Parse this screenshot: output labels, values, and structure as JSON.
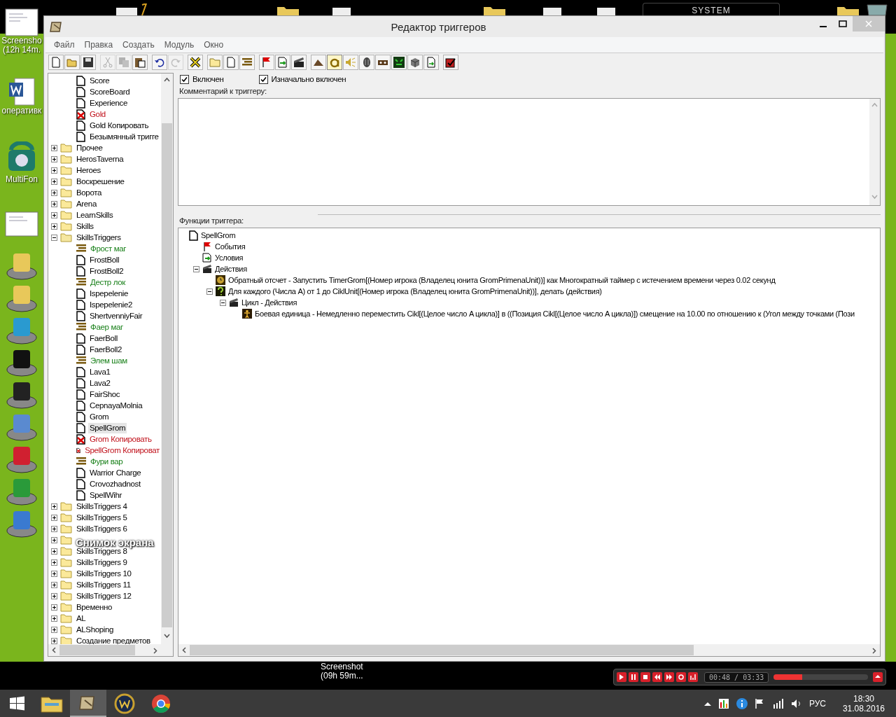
{
  "desktop": {
    "left_icons": [
      {
        "kind": "screenshot",
        "label": [
          "Screensho",
          "(12h 14m."
        ]
      },
      {
        "kind": "word",
        "label": [
          "оперативк"
        ]
      },
      {
        "kind": "phone",
        "label": [
          "MultiFon"
        ]
      },
      {
        "kind": "screenshot-small"
      },
      {
        "kind": "disk-folder"
      },
      {
        "kind": "disk-folder"
      },
      {
        "kind": "disk-signal"
      },
      {
        "kind": "disk-dollar"
      },
      {
        "kind": "disk-v"
      },
      {
        "kind": "disk-map"
      },
      {
        "kind": "disk-download"
      },
      {
        "kind": "disk-chrome"
      },
      {
        "kind": "disk-camera"
      }
    ],
    "overlay_label": "Снимок экрана",
    "system_label": "SYSTEM",
    "bottom_label": [
      "Screenshot",
      "(09h 59m..."
    ]
  },
  "window": {
    "title": "Редактор триггеров"
  },
  "menu": [
    "Файл",
    "Правка",
    "Создать",
    "Модуль",
    "Окно"
  ],
  "toolbar": [
    [
      {
        "kind": "new",
        "disabled": false,
        "pressed": false
      },
      {
        "kind": "open",
        "disabled": false,
        "pressed": false
      },
      {
        "kind": "save",
        "disabled": false,
        "pressed": false
      }
    ],
    [
      {
        "kind": "cut",
        "disabled": true,
        "pressed": false
      },
      {
        "kind": "copy",
        "disabled": true,
        "pressed": false
      },
      {
        "kind": "paste",
        "disabled": false,
        "pressed": false
      }
    ],
    [
      {
        "kind": "undo",
        "disabled": false,
        "pressed": false
      },
      {
        "kind": "redo",
        "disabled": true,
        "pressed": false
      }
    ],
    [
      {
        "kind": "delete",
        "disabled": false,
        "pressed": false
      }
    ],
    [
      {
        "kind": "folder",
        "disabled": false,
        "pressed": false
      },
      {
        "kind": "trigger",
        "disabled": false,
        "pressed": false
      },
      {
        "kind": "comment",
        "disabled": false,
        "pressed": false
      }
    ],
    [
      {
        "kind": "event",
        "disabled": false,
        "pressed": false
      },
      {
        "kind": "condition",
        "disabled": false,
        "pressed": false
      },
      {
        "kind": "action",
        "disabled": false,
        "pressed": false
      }
    ],
    [
      {
        "kind": "terrain",
        "disabled": false,
        "pressed": false
      },
      {
        "kind": "text",
        "disabled": false,
        "pressed": true
      },
      {
        "kind": "sound",
        "disabled": false,
        "pressed": false
      },
      {
        "kind": "unit",
        "disabled": false,
        "pressed": false
      },
      {
        "kind": "object",
        "disabled": false,
        "pressed": false
      },
      {
        "kind": "monster",
        "disabled": false,
        "pressed": false
      },
      {
        "kind": "cube",
        "disabled": false,
        "pressed": false
      },
      {
        "kind": "import",
        "disabled": false,
        "pressed": false
      }
    ],
    [
      {
        "kind": "checklist",
        "disabled": false,
        "pressed": false
      }
    ]
  ],
  "tree": {
    "continued_items": [
      {
        "kind": "trigger",
        "label": "Score",
        "selected": false
      },
      {
        "kind": "trigger",
        "label": "ScoreBoard",
        "selected": false
      },
      {
        "kind": "trigger",
        "label": "Experience",
        "selected": false
      },
      {
        "kind": "disabled-trigger",
        "label": "Gold",
        "selected": false
      },
      {
        "kind": "trigger",
        "label": "Gold Копировать",
        "selected": false
      },
      {
        "kind": "trigger",
        "label": "Безымянный тригге",
        "selected": false
      }
    ],
    "folders": [
      {
        "label": "Прочее",
        "expanded": false
      },
      {
        "label": "HerosTaverna",
        "expanded": false
      },
      {
        "label": "Heroes",
        "expanded": false
      },
      {
        "label": "Воскрешение",
        "expanded": false
      },
      {
        "label": "Ворота",
        "expanded": false
      },
      {
        "label": "Arena",
        "expanded": false
      },
      {
        "label": "LearnSkills",
        "expanded": false
      },
      {
        "label": "Skills",
        "expanded": false
      },
      {
        "label": "SkillsTriggers",
        "expanded": true,
        "children": [
          {
            "kind": "comment",
            "label": "Фрост маг",
            "selected": false
          },
          {
            "kind": "trigger",
            "label": "FrostBoll",
            "selected": false
          },
          {
            "kind": "trigger",
            "label": "FrostBoll2",
            "selected": false
          },
          {
            "kind": "comment",
            "label": "Дестр лок",
            "selected": false
          },
          {
            "kind": "trigger",
            "label": "Ispepelenie",
            "selected": false
          },
          {
            "kind": "trigger",
            "label": "Ispepelenie2",
            "selected": false
          },
          {
            "kind": "trigger",
            "label": "ShertvenniyFair",
            "selected": false
          },
          {
            "kind": "comment",
            "label": "Фаер маг",
            "selected": false
          },
          {
            "kind": "trigger",
            "label": "FaerBoll",
            "selected": false
          },
          {
            "kind": "trigger",
            "label": "FaerBoll2",
            "selected": false
          },
          {
            "kind": "comment",
            "label": "Элем шам",
            "selected": false
          },
          {
            "kind": "trigger",
            "label": "Lava1",
            "selected": false
          },
          {
            "kind": "trigger",
            "label": "Lava2",
            "selected": false
          },
          {
            "kind": "trigger",
            "label": "FairShoc",
            "selected": false
          },
          {
            "kind": "trigger",
            "label": "CepnayaMolnia",
            "selected": false
          },
          {
            "kind": "trigger",
            "label": "Grom",
            "selected": false
          },
          {
            "kind": "trigger",
            "label": "SpellGrom",
            "selected": true
          },
          {
            "kind": "disabled-trigger",
            "label": "Grom Копировать",
            "selected": false
          },
          {
            "kind": "disabled-trigger",
            "label": "SpellGrom Копироват",
            "selected": false
          },
          {
            "kind": "comment",
            "label": "Фури вар",
            "selected": false
          },
          {
            "kind": "trigger",
            "label": "Warrior Charge",
            "selected": false
          },
          {
            "kind": "trigger",
            "label": "Crovozhadnost",
            "selected": false
          },
          {
            "kind": "trigger",
            "label": "SpellWihr",
            "selected": false
          }
        ]
      },
      {
        "label": "SkillsTriggers 4",
        "expanded": false
      },
      {
        "label": "SkillsTriggers 5",
        "expanded": false
      },
      {
        "label": "SkillsTriggers 6",
        "expanded": false
      },
      {
        "expanded": false
      },
      {
        "label": "SkillsTriggers 8",
        "expanded": false
      },
      {
        "label": "SkillsTriggers 9",
        "expanded": false
      },
      {
        "label": "SkillsTriggers 10",
        "expanded": false
      },
      {
        "label": "SkillsTriggers 11",
        "expanded": false
      },
      {
        "label": "SkillsTriggers 12",
        "expanded": false
      },
      {
        "label": "Временно",
        "expanded": false
      },
      {
        "label": "AL",
        "expanded": false
      },
      {
        "label": "ALShoping",
        "expanded": false
      },
      {
        "label": "Создание предметов",
        "expanded": false
      }
    ]
  },
  "trigger_options": [
    {
      "label": "Включен",
      "checked": true
    },
    {
      "label": "Изначально включен",
      "checked": true
    }
  ],
  "comment": {
    "label": "Комментарий к триггеру:"
  },
  "functions": {
    "label": "Функции триггера:",
    "tree": [
      {
        "kind": "trigger",
        "label": "SpellGrom",
        "children": [
          {
            "kind": "event",
            "label": "События"
          },
          {
            "kind": "condition",
            "label": "Условия"
          },
          {
            "kind": "actions",
            "label": "Действия",
            "expanded": true,
            "children": [
              {
                "kind": "timer",
                "label": "Обратный отсчет - Запустить TimerGrom[(Номер игрока (Владелец юнита GromPrimenaUnit))] как Многократный таймер с истечением времени через 0.02 секунд"
              },
              {
                "kind": "loop",
                "label": "Для каждого (Числа A) от 1 до CiklUnit[(Номер игрока (Владелец юнита GromPrimenaUnit))], делать (действия)",
                "expanded": true,
                "children": [
                  {
                    "kind": "actions",
                    "label": "Цикл - Действия",
                    "expanded": true,
                    "children": [
                      {
                        "kind": "unit",
                        "label": "Боевая единица - Немедленно переместить Cikl[(Целое число A цикла)] в ((Позиция Cikl[(Целое число A цикла)]) смещение на 10.00 по отношению к (Угол между точками (Пози"
                      }
                    ]
                  }
                ]
              }
            ]
          }
        ]
      }
    ]
  },
  "player": {
    "time": "00:48 / 03:33",
    "level": 0.3
  },
  "taskbar": [
    {
      "kind": "explorer",
      "selected": false
    },
    {
      "kind": "editor",
      "selected": true
    },
    {
      "kind": "game",
      "selected": false
    },
    {
      "kind": "browser",
      "selected": false
    }
  ],
  "tray": {
    "language": "РУС",
    "time": "18:30",
    "date": "31.08.2016"
  }
}
